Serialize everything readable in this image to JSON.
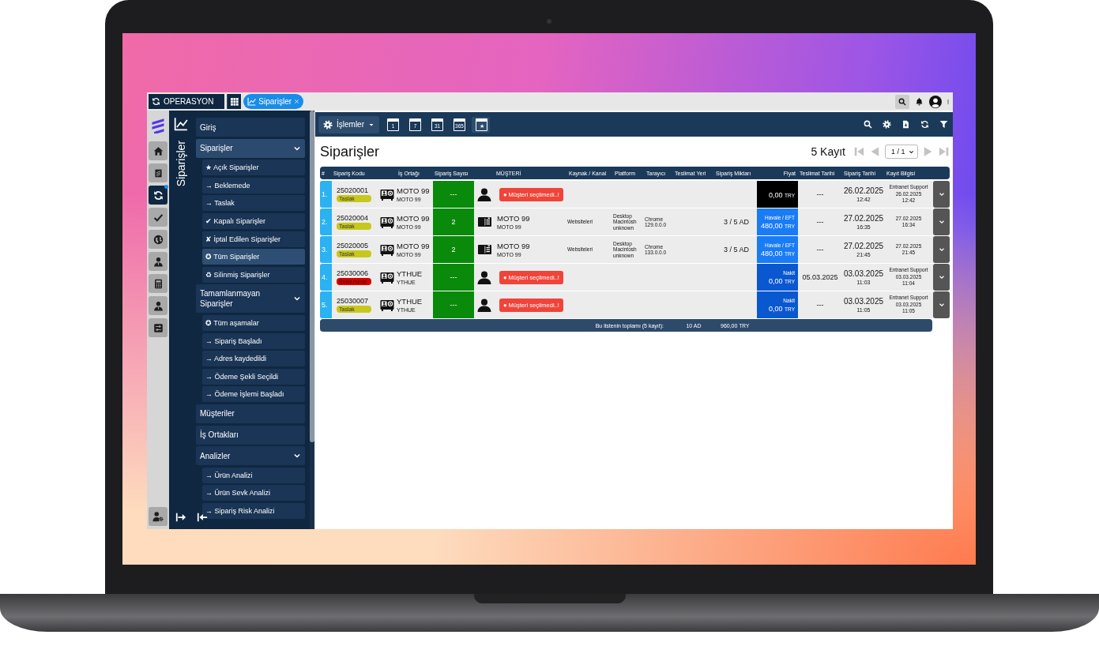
{
  "app_bar": {
    "module_button": "OPERASYON",
    "tabs": [
      {
        "label": "Siparişler",
        "selected": true
      }
    ]
  },
  "rail": {
    "items": [
      {
        "selected": false,
        "notified": false
      },
      {
        "selected": false,
        "notified": false
      },
      {
        "selected": true,
        "notified": true
      },
      {
        "selected": false,
        "notified": false
      },
      {
        "selected": false,
        "notified": false
      },
      {
        "selected": false,
        "notified": false
      },
      {
        "selected": false,
        "notified": false
      },
      {
        "selected": false,
        "notified": false
      },
      {
        "selected": false,
        "notified": false
      }
    ]
  },
  "sidebar": {
    "title": "Siparişler",
    "menu": [
      {
        "label": "Giriş",
        "selected": false
      },
      {
        "label": "Siparişler",
        "selected": true,
        "expanded": true,
        "children": [
          {
            "label": "★ Açık Siparişler",
            "selected": false
          },
          {
            "label": "→ Beklemede",
            "selected": false
          },
          {
            "label": "→ Taslak",
            "selected": false
          },
          {
            "label": "✔ Kapalı Siparişler",
            "selected": false
          },
          {
            "label": "✘ İptal Edilen Siparişler",
            "selected": false
          },
          {
            "label": "✪ Tüm Siparişler",
            "selected": true
          },
          {
            "label": "♻ Silinmiş Siparişler",
            "selected": false
          }
        ]
      },
      {
        "label": "Tamamlanmayan Siparişler",
        "selected": false,
        "expanded": true,
        "children": [
          {
            "label": "✪ Tüm aşamalar",
            "selected": false
          },
          {
            "label": "→ Sipariş Başladı",
            "selected": false
          },
          {
            "label": "→ Adres kaydedildi",
            "selected": false
          },
          {
            "label": "→ Ödeme Şekli Seçildi",
            "selected": false
          },
          {
            "label": "→ Ödeme İşlemi Başladı",
            "selected": false
          }
        ]
      },
      {
        "label": "Müşteriler",
        "selected": false
      },
      {
        "label": "İş Ortakları",
        "selected": false
      },
      {
        "label": "Analizler",
        "selected": false,
        "expanded": true,
        "children": [
          {
            "label": "→ Ürün Analizi",
            "selected": false
          },
          {
            "label": "→ Ürün Sevk Analizi",
            "selected": false
          },
          {
            "label": "→ Sipariş Risk Analizi",
            "selected": false
          }
        ]
      }
    ]
  },
  "toolbar": {
    "actions_button": "İşlemler",
    "date_filters": [
      {
        "label": "1",
        "selected": false
      },
      {
        "label": "7",
        "selected": false
      },
      {
        "label": "31",
        "selected": false
      },
      {
        "label": "365",
        "selected": false
      },
      {
        "label": "★",
        "selected": true
      }
    ]
  },
  "page": {
    "title": "Siparişler",
    "record_count": "5 Kayıt",
    "page_select": "1 / 1"
  },
  "table": {
    "columns": [
      "#",
      "Sipariş Kodu",
      "İş Ortağı",
      "Sipariş Sayısı",
      "MÜŞTERİ",
      "Kaynak / Kanal",
      "Platform",
      "Tarayıcı",
      "Teslimat Yeri",
      "Sipariş Miktarı",
      "Fiyat",
      "Teslimat Tarihi",
      "Sipariş Tarihi",
      "Kayıt Bilgisi"
    ],
    "rows": [
      {
        "number": "1.",
        "code": "25020001",
        "status": {
          "label": "Taslak",
          "kind": "draft"
        },
        "partner": "MOTO 99",
        "partner_sub": "MOTO 99",
        "order_count": "---",
        "customer": {
          "kind": "missing",
          "label": "● Müşteri seçilmedi..!"
        },
        "price": {
          "kind": "none",
          "amount": "0,00",
          "currency": "TRY"
        },
        "delivery_date": "---",
        "order_date": "26.02.2025",
        "order_time": "12:42",
        "record": [
          "Entranet Support",
          "26.02.2025",
          "12:42"
        ]
      },
      {
        "number": "2.",
        "code": "25020004",
        "status": {
          "label": "Taslak",
          "kind": "draft"
        },
        "partner": "MOTO 99",
        "partner_sub": "MOTO 99",
        "order_count": "2",
        "customer": {
          "kind": "card",
          "name": "MOTO 99",
          "sub": "MOTO 99"
        },
        "source": "Websiteleri",
        "platform": [
          "Desktop",
          "Macintosh",
          "unknown"
        ],
        "browser": [
          "Chrome",
          "129.0.0.0"
        ],
        "quantity": "3 / 5 AD",
        "price": {
          "kind": "bank",
          "method": "Havale / EFT",
          "amount": "480,00",
          "currency": "TRY"
        },
        "delivery_date": "---",
        "order_date": "27.02.2025",
        "order_time": "16:35",
        "record": [
          "27.02.2025",
          "16:34"
        ]
      },
      {
        "number": "3.",
        "code": "25020005",
        "status": {
          "label": "Taslak",
          "kind": "draft"
        },
        "partner": "MOTO 99",
        "partner_sub": "MOTO 99",
        "order_count": "2",
        "customer": {
          "kind": "card",
          "name": "MOTO 99",
          "sub": "MOTO 99"
        },
        "source": "Websiteleri",
        "platform": [
          "Desktop",
          "Macintosh",
          "unknown"
        ],
        "browser": [
          "Chrome",
          "133.0.0.0"
        ],
        "quantity": "3 / 5 AD",
        "price": {
          "kind": "bank",
          "method": "Havale / EFT",
          "amount": "480,00",
          "currency": "TRY"
        },
        "delivery_date": "---",
        "order_date": "27.02.2025",
        "order_time": "21:45",
        "record": [
          "27.02.2025",
          "21:45"
        ]
      },
      {
        "number": "4.",
        "code": "25030006",
        "status": {
          "label": "Beklemede",
          "kind": "waiting"
        },
        "partner": "YTHUE",
        "partner_sub": "YTHUE",
        "order_count": "---",
        "customer": {
          "kind": "missing",
          "label": "● Müşteri seçilmedi..!"
        },
        "price": {
          "kind": "cash",
          "method": "Nakit",
          "amount": "0,00",
          "currency": "TRY"
        },
        "delivery_date": "05.03.2025",
        "order_date": "03.03.2025",
        "order_time": "11:03",
        "record": [
          "Entranet Support",
          "03.03.2025",
          "11:04"
        ]
      },
      {
        "number": "5.",
        "code": "25030007",
        "status": {
          "label": "Taslak",
          "kind": "draft"
        },
        "partner": "YTHUE",
        "partner_sub": "YTHUE",
        "order_count": "---",
        "customer": {
          "kind": "missing",
          "label": "● Müşteri seçilmedi..!"
        },
        "price": {
          "kind": "cash",
          "method": "Nakit",
          "amount": "0,00",
          "currency": "TRY"
        },
        "delivery_date": "---",
        "order_date": "03.03.2025",
        "order_time": "11:05",
        "record": [
          "Entranet Support",
          "03.03.2025",
          "11:05"
        ]
      }
    ],
    "footer": {
      "label": "Bu listenin toplamı (5 kayıt):",
      "quantity": "10 AD",
      "amount": "960,00",
      "currency": "TRY"
    }
  }
}
